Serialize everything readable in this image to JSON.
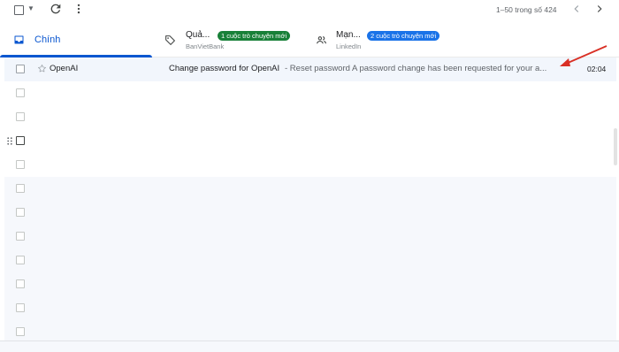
{
  "toolbar": {
    "range_text": "1–50 trong số 424",
    "icons": [
      "checkbox-icon",
      "caret-down-icon",
      "refresh-icon",
      "more-vert-icon",
      "chevron-left-icon",
      "chevron-right-icon"
    ]
  },
  "tabs": {
    "primary": {
      "label": "Chính"
    },
    "promotions": {
      "label": "Quả...",
      "badge": "1 cuộc trò chuyện mới",
      "sender": "BanVietBank"
    },
    "social": {
      "label": "Mạn...",
      "badge": "2 cuộc trò chuyện mới",
      "sender": "LinkedIn"
    }
  },
  "email": {
    "sender": "OpenAI",
    "subject": "Change password for OpenAI",
    "snippet": " - Reset password A password change has been requested for your a...",
    "time": "02:04"
  },
  "colors": {
    "accent": "#0b57d0",
    "badge_green": "#188038",
    "badge_blue": "#1a73e8",
    "annotation_arrow": "#d93025"
  }
}
